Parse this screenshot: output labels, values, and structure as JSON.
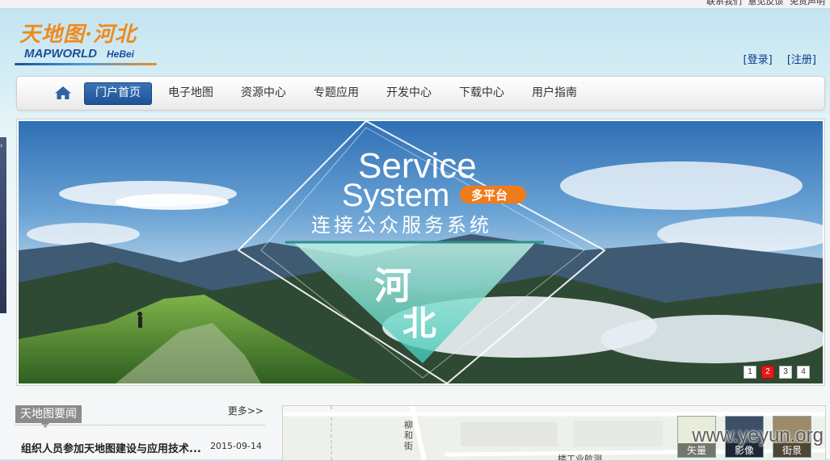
{
  "top_links": [
    "联系我们",
    "意见反馈",
    "免责声明"
  ],
  "logo": {
    "cn": "天地图·河北",
    "en": "MAPWORLD",
    "en_sub": "HeBei"
  },
  "auth": {
    "login": "[登录]",
    "register": "[注册]"
  },
  "nav": {
    "items": [
      "门户首页",
      "电子地图",
      "资源中心",
      "专题应用",
      "开发中心",
      "下载中心",
      "用户指南"
    ],
    "active_index": 0
  },
  "banner": {
    "line1": "Service",
    "line2": "System",
    "badge": "多平台",
    "subtitle": "连接公众服务系统",
    "center": "河北",
    "pages": [
      "1",
      "2",
      "3",
      "4"
    ],
    "current_page": "2"
  },
  "news": {
    "title": "天地图要闻",
    "more": "更多>>",
    "items": [
      {
        "title": "组织人员参加天地图建设与应用技术...",
        "date": "2015-09-14"
      }
    ]
  },
  "map": {
    "labels": [
      "柳",
      "和",
      "街",
      "楼工业航测"
    ],
    "buttons": [
      "矢量",
      "影像",
      "街景"
    ]
  },
  "watermark": "www.yeyun.org",
  "colors": {
    "accent": "#1f5294",
    "logo_orange": "#f08a1c",
    "pager_active": "#e21b1b"
  }
}
